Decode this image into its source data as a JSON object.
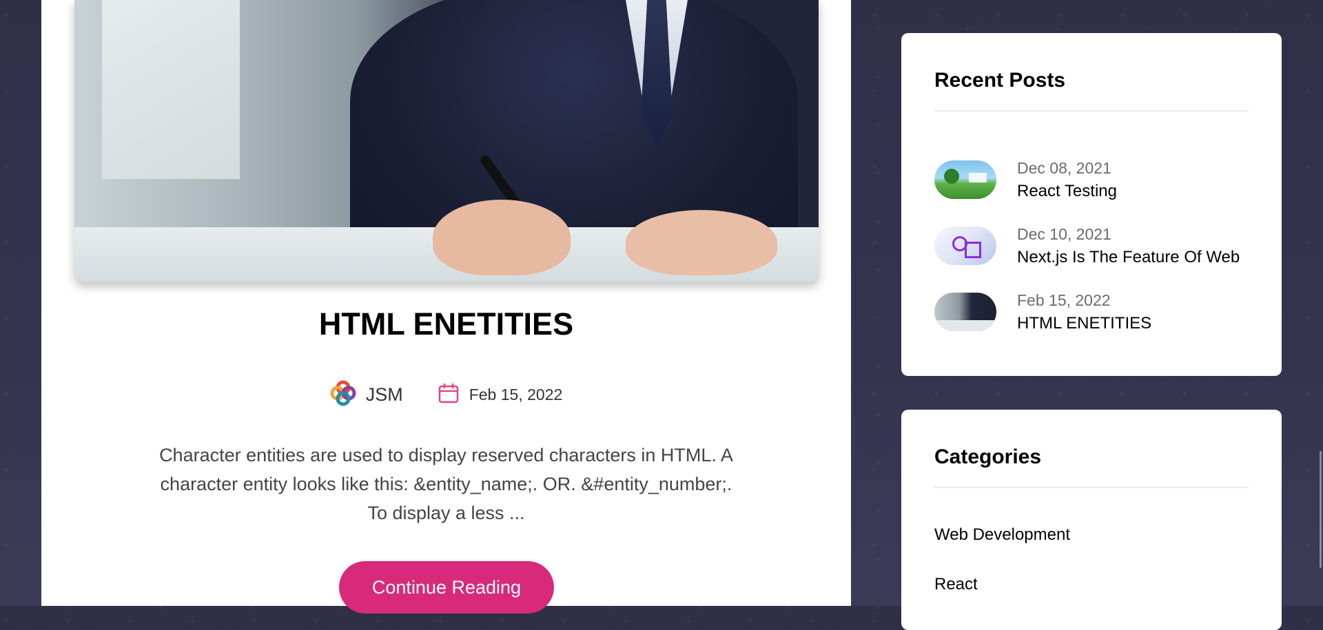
{
  "post": {
    "title": "HTML ENETITIES",
    "author": "JSM",
    "date": "Feb 15, 2022",
    "excerpt": "Character entities are used to display reserved characters in HTML. A character entity looks like this: &entity_name;. OR. &#entity_number;. To display a less ...",
    "cta": "Continue Reading"
  },
  "sidebar": {
    "recent_title": "Recent Posts",
    "recent": [
      {
        "date": "Dec 08, 2021",
        "title": "React Testing"
      },
      {
        "date": "Dec 10, 2021",
        "title": "Next.js Is The Feature Of Web"
      },
      {
        "date": "Feb 15, 2022",
        "title": "HTML ENETITIES"
      }
    ],
    "categories_title": "Categories",
    "categories": [
      "Web Development",
      "React"
    ]
  },
  "colors": {
    "accent": "#d9297a",
    "background": "#2e2e47"
  }
}
